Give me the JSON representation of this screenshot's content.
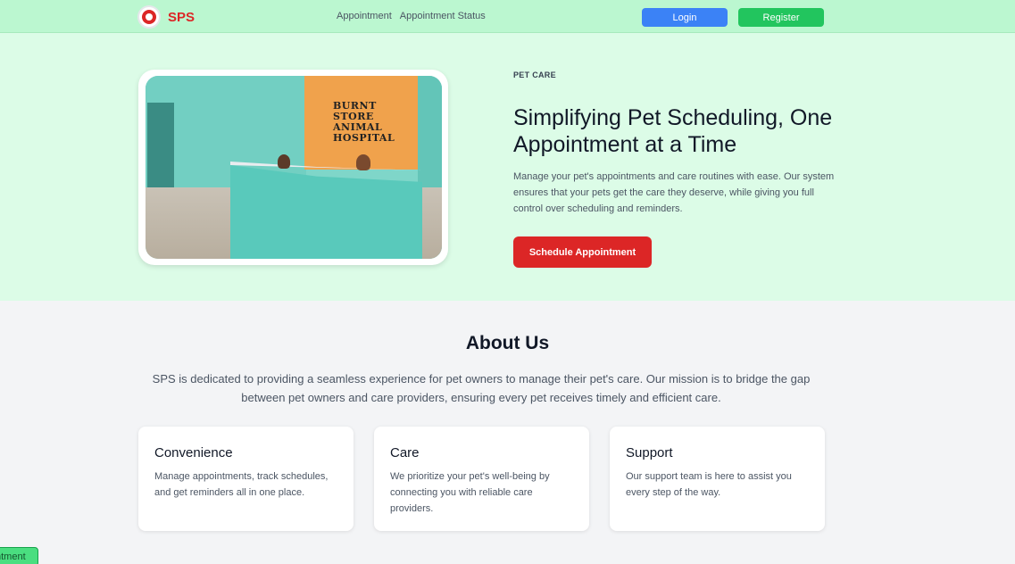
{
  "nav": {
    "brand": "SPS",
    "links": [
      "Appointment",
      "Appointment Status"
    ],
    "login_label": "Login",
    "register_label": "Register"
  },
  "hero": {
    "eyebrow": "PET CARE",
    "title": "Simplifying Pet Scheduling, One Appointment at a Time",
    "description": "Manage your pet's appointments and care routines with ease. Our system ensures that your pets get the care they deserve, while giving you full control over scheduling and reminders.",
    "cta_label": "Schedule Appointment",
    "image_sign": "BURNT STORE ANIMAL HOSPITAL"
  },
  "about": {
    "title": "About Us",
    "description": "SPS is dedicated to providing a seamless experience for pet owners to manage their pet's care. Our mission is to bridge the gap between pet owners and care providers, ensuring every pet receives timely and efficient care.",
    "cards": [
      {
        "title": "Convenience",
        "text": "Manage appointments, track schedules, and get reminders all in one place."
      },
      {
        "title": "Care",
        "text": "We prioritize your pet's well-being by connecting you with reliable care providers."
      },
      {
        "title": "Support",
        "text": "Our support team is here to assist you every step of the way."
      }
    ]
  },
  "floating_tab_label": "ntment",
  "colors": {
    "nav_bg": "#bbf7d0",
    "hero_bg": "#dcfce7",
    "brand_red": "#dc2626",
    "login_blue": "#3b82f6",
    "register_green": "#22c55e"
  }
}
